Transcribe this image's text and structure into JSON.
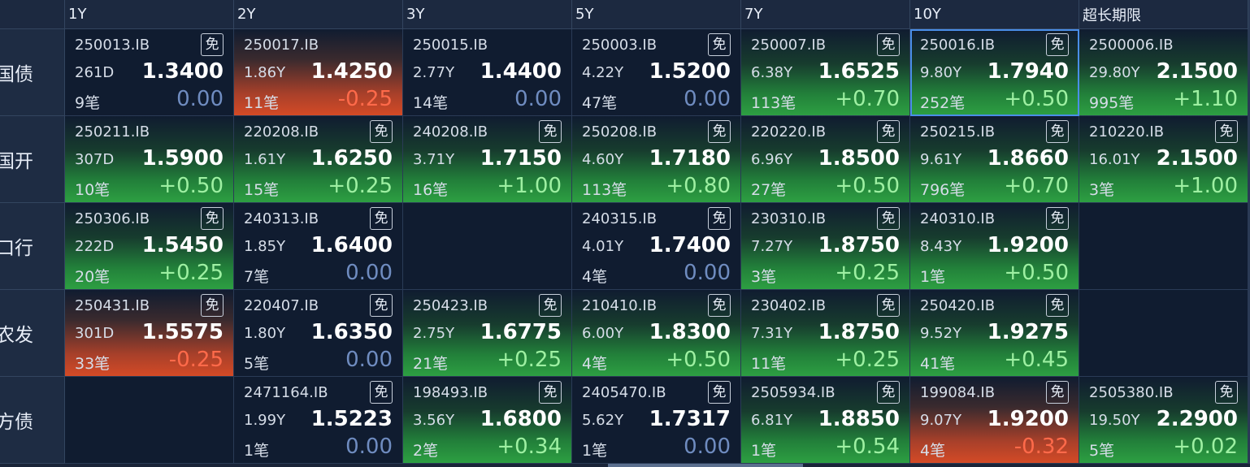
{
  "columns": [
    "1Y",
    "2Y",
    "3Y",
    "5Y",
    "7Y",
    "10Y",
    "超长期限"
  ],
  "mian_label": "免",
  "rows": [
    {
      "label": "国债",
      "cells": [
        {
          "code": "250013.IB",
          "mian": true,
          "term": "261D",
          "yield": "1.3400",
          "count": "9笔",
          "change": "0.00",
          "trend": "zero"
        },
        {
          "code": "250017.IB",
          "mian": false,
          "term": "1.86Y",
          "yield": "1.4250",
          "count": "11笔",
          "change": "-0.25",
          "trend": "neg"
        },
        {
          "code": "250015.IB",
          "mian": false,
          "term": "2.77Y",
          "yield": "1.4400",
          "count": "14笔",
          "change": "0.00",
          "trend": "zero"
        },
        {
          "code": "250003.IB",
          "mian": true,
          "term": "4.22Y",
          "yield": "1.5200",
          "count": "47笔",
          "change": "0.00",
          "trend": "zero"
        },
        {
          "code": "250007.IB",
          "mian": true,
          "term": "6.38Y",
          "yield": "1.6525",
          "count": "113笔",
          "change": "+0.70",
          "trend": "pos"
        },
        {
          "code": "250016.IB",
          "mian": true,
          "term": "9.80Y",
          "yield": "1.7940",
          "count": "252笔",
          "change": "+0.50",
          "trend": "pos",
          "selected": true
        },
        {
          "code": "2500006.IB",
          "mian": false,
          "term": "29.80Y",
          "yield": "2.1500",
          "count": "995笔",
          "change": "+1.10",
          "trend": "pos"
        }
      ]
    },
    {
      "label": "国开",
      "cells": [
        {
          "code": "250211.IB",
          "mian": false,
          "term": "307D",
          "yield": "1.5900",
          "count": "10笔",
          "change": "+0.50",
          "trend": "pos"
        },
        {
          "code": "220208.IB",
          "mian": true,
          "term": "1.61Y",
          "yield": "1.6250",
          "count": "15笔",
          "change": "+0.25",
          "trend": "pos"
        },
        {
          "code": "240208.IB",
          "mian": true,
          "term": "3.71Y",
          "yield": "1.7150",
          "count": "16笔",
          "change": "+1.00",
          "trend": "pos"
        },
        {
          "code": "250208.IB",
          "mian": true,
          "term": "4.60Y",
          "yield": "1.7180",
          "count": "113笔",
          "change": "+0.80",
          "trend": "pos"
        },
        {
          "code": "220220.IB",
          "mian": true,
          "term": "6.96Y",
          "yield": "1.8500",
          "count": "27笔",
          "change": "+0.50",
          "trend": "pos"
        },
        {
          "code": "250215.IB",
          "mian": true,
          "term": "9.61Y",
          "yield": "1.8660",
          "count": "796笔",
          "change": "+0.70",
          "trend": "pos"
        },
        {
          "code": "210220.IB",
          "mian": true,
          "term": "16.01Y",
          "yield": "2.1500",
          "count": "3笔",
          "change": "+1.00",
          "trend": "pos"
        }
      ]
    },
    {
      "label": "口行",
      "cells": [
        {
          "code": "250306.IB",
          "mian": true,
          "term": "222D",
          "yield": "1.5450",
          "count": "20笔",
          "change": "+0.25",
          "trend": "pos"
        },
        {
          "code": "240313.IB",
          "mian": true,
          "term": "1.85Y",
          "yield": "1.6400",
          "count": "7笔",
          "change": "0.00",
          "trend": "zero"
        },
        null,
        {
          "code": "240315.IB",
          "mian": true,
          "term": "4.01Y",
          "yield": "1.7400",
          "count": "4笔",
          "change": "0.00",
          "trend": "zero"
        },
        {
          "code": "230310.IB",
          "mian": true,
          "term": "7.27Y",
          "yield": "1.8750",
          "count": "3笔",
          "change": "+0.25",
          "trend": "pos"
        },
        {
          "code": "240310.IB",
          "mian": true,
          "term": "8.43Y",
          "yield": "1.9200",
          "count": "1笔",
          "change": "+0.50",
          "trend": "pos"
        },
        null
      ]
    },
    {
      "label": "农发",
      "cells": [
        {
          "code": "250431.IB",
          "mian": true,
          "term": "301D",
          "yield": "1.5575",
          "count": "33笔",
          "change": "-0.25",
          "trend": "neg"
        },
        {
          "code": "220407.IB",
          "mian": true,
          "term": "1.80Y",
          "yield": "1.6350",
          "count": "5笔",
          "change": "0.00",
          "trend": "zero"
        },
        {
          "code": "250423.IB",
          "mian": true,
          "term": "2.75Y",
          "yield": "1.6775",
          "count": "21笔",
          "change": "+0.25",
          "trend": "pos"
        },
        {
          "code": "210410.IB",
          "mian": true,
          "term": "6.00Y",
          "yield": "1.8300",
          "count": "4笔",
          "change": "+0.50",
          "trend": "pos"
        },
        {
          "code": "230402.IB",
          "mian": true,
          "term": "7.31Y",
          "yield": "1.8750",
          "count": "11笔",
          "change": "+0.25",
          "trend": "pos"
        },
        {
          "code": "250420.IB",
          "mian": true,
          "term": "9.52Y",
          "yield": "1.9275",
          "count": "41笔",
          "change": "+0.45",
          "trend": "pos"
        },
        null
      ]
    },
    {
      "label": "地方债",
      "cells": [
        null,
        {
          "code": "2471164.IB",
          "mian": true,
          "term": "1.99Y",
          "yield": "1.5223",
          "count": "1笔",
          "change": "0.00",
          "trend": "zero"
        },
        {
          "code": "198493.IB",
          "mian": true,
          "term": "3.56Y",
          "yield": "1.6800",
          "count": "2笔",
          "change": "+0.34",
          "trend": "pos"
        },
        {
          "code": "2405470.IB",
          "mian": true,
          "term": "5.62Y",
          "yield": "1.7317",
          "count": "1笔",
          "change": "0.00",
          "trend": "zero"
        },
        {
          "code": "2505934.IB",
          "mian": true,
          "term": "6.81Y",
          "yield": "1.8850",
          "count": "1笔",
          "change": "+0.54",
          "trend": "pos"
        },
        {
          "code": "199084.IB",
          "mian": true,
          "term": "9.07Y",
          "yield": "1.9200",
          "count": "4笔",
          "change": "-0.32",
          "trend": "neg"
        },
        {
          "code": "2505380.IB",
          "mian": true,
          "term": "19.50Y",
          "yield": "2.2900",
          "count": "5笔",
          "change": "+0.02",
          "trend": "pos"
        }
      ]
    }
  ],
  "colors": {
    "positive": "#9ef0a2",
    "negative": "#ff6a4a",
    "zero": "#6f8cc0",
    "selection": "#4a8ee8",
    "background": "#101c30"
  }
}
